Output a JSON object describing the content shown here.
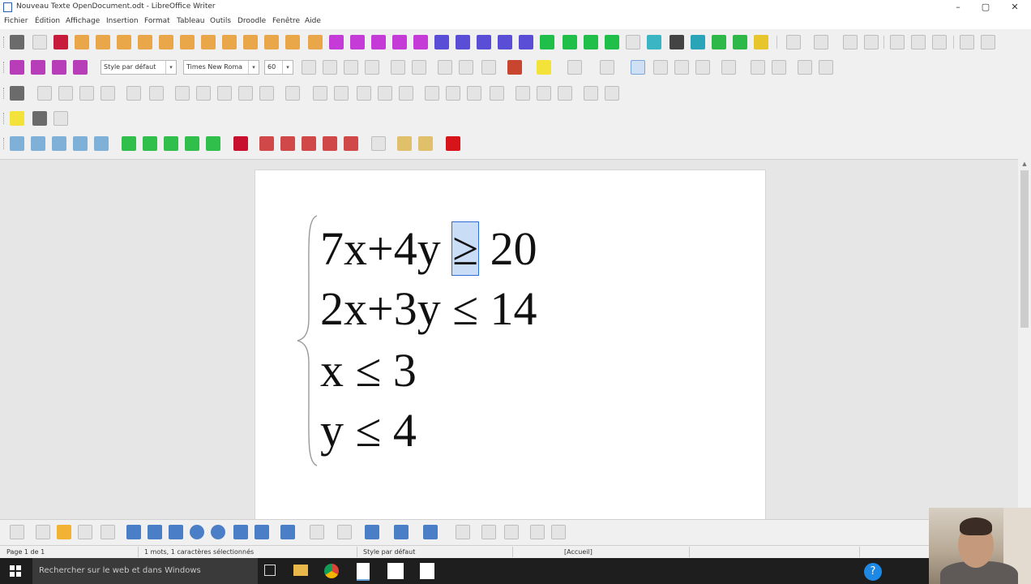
{
  "window": {
    "title": "Nouveau Texte OpenDocument.odt - LibreOffice Writer",
    "controls": {
      "minimize": "–",
      "maximize": "▢",
      "close": "✕"
    }
  },
  "menu": [
    "Fichier",
    "Édition",
    "Affichage",
    "Insertion",
    "Format",
    "Tableau",
    "Outils",
    "Droodle",
    "Fenêtre",
    "Aide"
  ],
  "formatting": {
    "paragraph_style": "Style par défaut",
    "font_name": "Times New Roma",
    "font_size": "60"
  },
  "document": {
    "system_brace": "{",
    "equations": [
      {
        "before": "7x+4y ",
        "selected": "≥",
        "after": " 20"
      },
      {
        "before": "2x+3y ≤ 14",
        "selected": "",
        "after": ""
      },
      {
        "before": "x ≤ 3",
        "selected": "",
        "after": ""
      },
      {
        "before": "y ≤ 4",
        "selected": "",
        "after": ""
      }
    ]
  },
  "statusbar": {
    "page": "Page 1 de 1",
    "words": "1 mots, 1 caractères sélectionnés",
    "style": "Style par défaut",
    "language": "[Accueil]"
  },
  "taskbar": {
    "search_placeholder": "Rechercher sur le web et dans Windows"
  },
  "colors": {
    "accent_selection": "#c9ddf6",
    "selection_border": "#2f6fd0",
    "toolbar_bg": "#f0f0f0",
    "page_bg": "#ffffff"
  }
}
